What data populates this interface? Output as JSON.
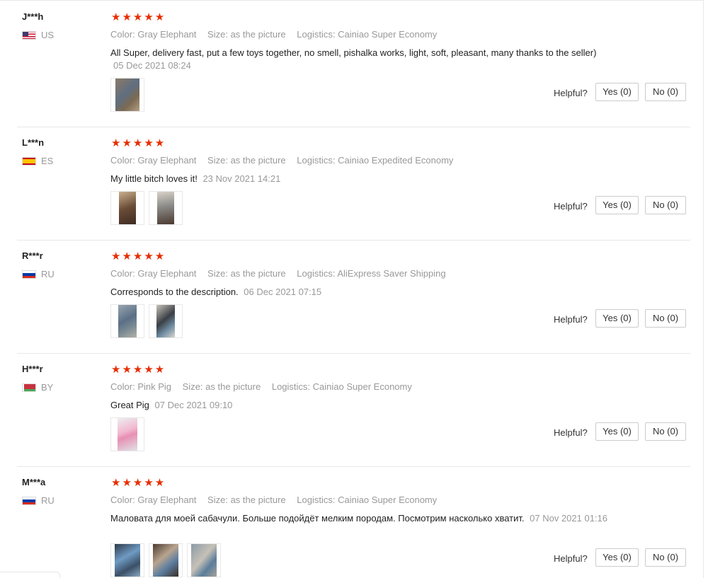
{
  "labels": {
    "color": "Color:",
    "size": "Size:",
    "logistics": "Logistics:",
    "helpful": "Helpful?",
    "yes": "Yes (0)",
    "no": "No (0)",
    "stars": "★★★★★"
  },
  "reviews": [
    {
      "user": "J***h",
      "country": "US",
      "flag": "us",
      "rating": 5,
      "color": "Gray Elephant",
      "size": "as the picture",
      "logistics": "Cainiao Super Economy",
      "text": "All Super, delivery fast, put a few toys together, no smell, pishalka works, light, soft, pleasant, many thanks to the seller)",
      "date": "05 Dec 2021 08:24",
      "photos": [
        "photo-gray-elephant-1"
      ]
    },
    {
      "user": "L***n",
      "country": "ES",
      "flag": "es",
      "rating": 5,
      "color": "Gray Elephant",
      "size": "as the picture",
      "logistics": "Cainiao Expedited Economy",
      "text": "My little bitch loves it!",
      "date": "23 Nov 2021 14:21",
      "photos": [
        "photo-dog-1",
        "photo-dog-2"
      ]
    },
    {
      "user": "R***r",
      "country": "RU",
      "flag": "ru",
      "rating": 5,
      "color": "Gray Elephant",
      "size": "as the picture",
      "logistics": "AliExpress Saver Shipping",
      "text": "Corresponds to the description.",
      "date": "06 Dec 2021 07:15",
      "photos": [
        "photo-toy-1",
        "photo-toy-2"
      ]
    },
    {
      "user": "H***r",
      "country": "BY",
      "flag": "by",
      "rating": 5,
      "color": "Pink Pig",
      "size": "as the picture",
      "logistics": "Cainiao Super Economy",
      "text": "Great Pig",
      "date": "07 Dec 2021 09:10",
      "photos": [
        "photo-pink-pig"
      ]
    },
    {
      "user": "M***a",
      "country": "RU",
      "flag": "ru",
      "rating": 5,
      "color": "Gray Elephant",
      "size": "as the picture",
      "logistics": "Cainiao Super Economy",
      "text": "Маловата для моей сабачули. Больше подойдёт мелким породам. Посмотрим насколько хватит.",
      "date": "07 Nov 2021 01:16",
      "photos": [
        "photo-toy-3",
        "photo-toy-4",
        "photo-toy-5"
      ]
    }
  ]
}
